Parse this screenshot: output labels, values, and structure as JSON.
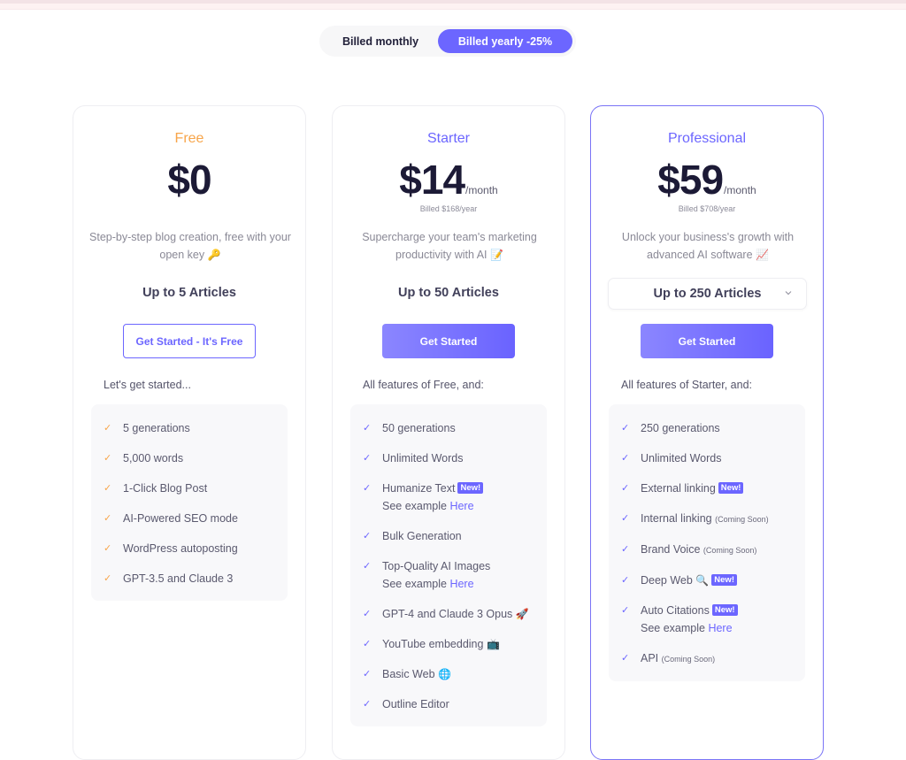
{
  "billing_toggle": {
    "monthly_label": "Billed monthly",
    "yearly_label": "Billed yearly -25%",
    "selected": "yearly"
  },
  "colors": {
    "accent": "#6c66ff",
    "free_accent": "#f7a54a",
    "price_text": "#1c1a36"
  },
  "plans": [
    {
      "name": "Free",
      "price": "$0",
      "period": "",
      "billed_note": "",
      "description": "Step-by-step blog creation, free with your open key",
      "description_emoji": "🔑",
      "articles": "Up to 5 Articles",
      "cta": "Get Started - It's Free",
      "features_intro": "Let's get started...",
      "features": [
        {
          "text": "5 generations"
        },
        {
          "text": "5,000 words"
        },
        {
          "text": "1-Click Blog Post"
        },
        {
          "text": "AI-Powered SEO mode"
        },
        {
          "text": "WordPress autoposting"
        },
        {
          "text": "GPT-3.5 and Claude 3"
        }
      ]
    },
    {
      "name": "Starter",
      "price": "$14",
      "period": "/month",
      "billed_note": "Billed $168/year",
      "description": "Supercharge your team's marketing productivity with AI",
      "description_emoji": "📝",
      "articles": "Up to 50 Articles",
      "cta": "Get Started",
      "features_intro": "All features of Free, and:",
      "features": [
        {
          "text": "50 generations"
        },
        {
          "text": "Unlimited Words"
        },
        {
          "text": "Humanize Text",
          "badge": "New!",
          "sub": "See example",
          "link": "Here"
        },
        {
          "text": "Bulk Generation"
        },
        {
          "text": "Top-Quality AI Images",
          "sub": "See example",
          "link": "Here"
        },
        {
          "text": "GPT-4 and Claude 3 Opus",
          "emoji": "🚀"
        },
        {
          "text": "YouTube embedding",
          "emoji": "📺"
        },
        {
          "text": "Basic Web",
          "emoji": "🌐"
        },
        {
          "text": "Outline Editor"
        }
      ]
    },
    {
      "name": "Professional",
      "price": "$59",
      "period": "/month",
      "billed_note": "Billed $708/year",
      "description": "Unlock your business's growth with advanced AI software",
      "description_emoji": "📈",
      "articles": "Up to 250 Articles",
      "cta": "Get Started",
      "features_intro": "All features of Starter, and:",
      "features": [
        {
          "text": "250 generations"
        },
        {
          "text": "Unlimited Words"
        },
        {
          "text": "External linking",
          "badge": "New!"
        },
        {
          "text": "Internal linking",
          "note": "(Coming Soon)"
        },
        {
          "text": "Brand Voice",
          "note": "(Coming Soon)"
        },
        {
          "text": "Deep Web",
          "emoji": "🔍",
          "badge": "New!"
        },
        {
          "text": "Auto Citations",
          "badge": "New!",
          "sub": "See example",
          "link": "Here"
        },
        {
          "text": "API",
          "note": "(Coming Soon)"
        }
      ]
    }
  ]
}
